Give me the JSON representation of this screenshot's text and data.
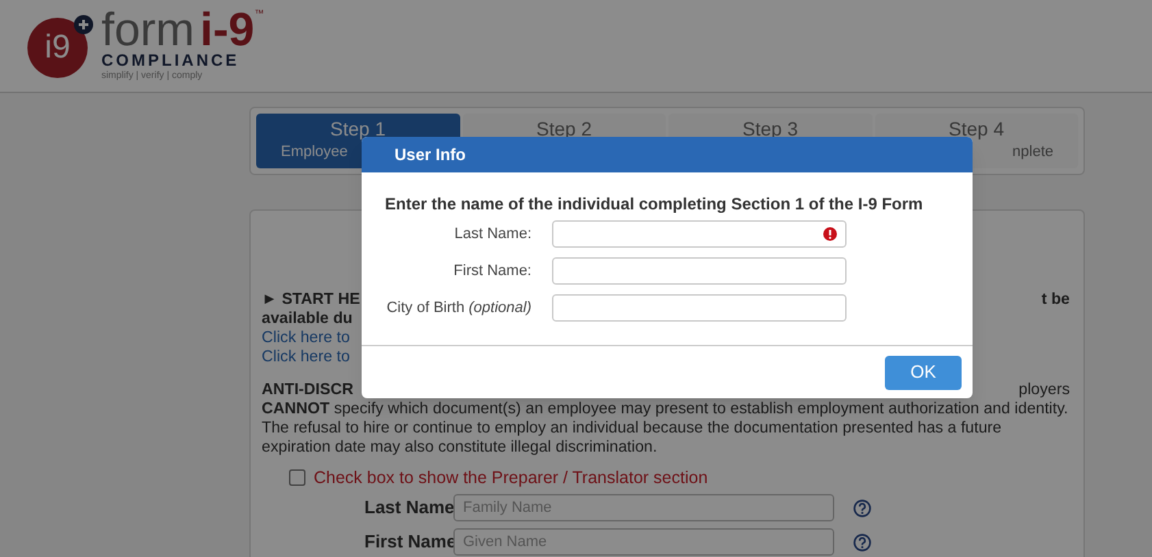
{
  "logo": {
    "mark": "i9",
    "name_prefix": "form",
    "name_suffix": "i-9",
    "trademark": "™",
    "subtitle": "COMPLIANCE",
    "tagline": "simplify | verify | comply"
  },
  "steps": [
    {
      "label": "Step 1",
      "caption": "Employee",
      "selected": true
    },
    {
      "label": "Step 2",
      "selected": false
    },
    {
      "label": "Step 3",
      "selected": false
    },
    {
      "label": "Step 4",
      "caption": "nplete",
      "selected": false
    }
  ],
  "page": {
    "intro": [
      {
        "left": "► START HE",
        "right": "t be"
      },
      {
        "left": "available du"
      }
    ],
    "links": [
      "Click here to",
      "Click here to"
    ],
    "notice": {
      "left": "ANTI-DISCR",
      "right": "ployers",
      "rest": "**CANNOT** specify which document(s) an employee may present to establish employment authorization and identity. The refusal to hire or continue to employ an individual because the documentation presented has a future expiration date may also constitute illegal discrimination."
    },
    "preparer_checkbox": {
      "label": "Check box to show the Preparer / Translator section",
      "checked": false
    },
    "fields": [
      {
        "label": "Last Name",
        "placeholder": "Family Name"
      },
      {
        "label": "First Name",
        "placeholder": "Given Name"
      }
    ]
  },
  "dialog": {
    "title": "User Info",
    "prompt": "Enter the name of the individual completing Section 1 of the I-9 Form",
    "fields": [
      {
        "label": "Last Name:",
        "error": true
      },
      {
        "label": "First Name:",
        "error": false
      },
      {
        "label": "City of Birth",
        "note": "(optional)",
        "error": false
      }
    ],
    "button": "OK"
  }
}
